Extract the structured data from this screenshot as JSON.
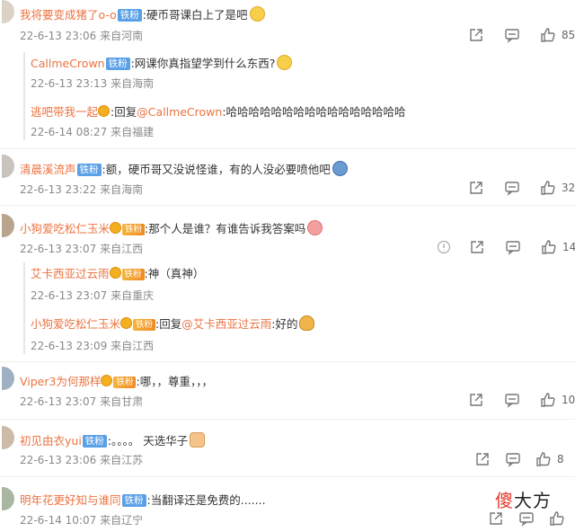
{
  "comments": [
    {
      "user": "我将要变成猪了o-o",
      "badge": "铁粉",
      "text": ":硬币哥课白上了是吧",
      "time": "22-6-13 23:06",
      "loc": "来自河南",
      "likes": "85",
      "replies": [
        {
          "user": "CallmeCrown",
          "badge": "铁粉",
          "text": ":网课你真指望学到什么东西?",
          "time": "22-6-13 23:13",
          "loc": "来自海南"
        },
        {
          "user": "逃吧带我一起",
          "prefix": ":回复",
          "mention": "@CallmeCrown",
          "text": ":哈哈哈哈哈哈哈哈哈哈哈哈哈哈哈哈",
          "time": "22-6-14 08:27",
          "loc": "来自福建"
        }
      ]
    },
    {
      "user": "清晨溪流声",
      "badge": "铁粉",
      "text": ":额，硬币哥又没说怪谁，有的人没必要喷他吧",
      "time": "22-6-13 23:22",
      "loc": "来自海南",
      "likes": "32"
    },
    {
      "user": "小狗爱吃松仁玉米",
      "badge": "铁粉",
      "text": ":那个人是谁？有谁告诉我答案吗",
      "time": "22-6-13 23:07",
      "loc": "来自江西",
      "likes": "14",
      "replies": [
        {
          "user": "艾卡西亚过云雨",
          "badge": "铁粉",
          "text": ":神（真神）",
          "time": "22-6-13 23:07",
          "loc": "来自重庆"
        },
        {
          "user": "小狗爱吃松仁玉米",
          "badge": "铁粉",
          "prefix": ":回复",
          "mention": "@艾卡西亚过云雨",
          "text": ":好的",
          "time": "22-6-13 23:09",
          "loc": "来自江西"
        }
      ]
    },
    {
      "user": "Viper3为何那样",
      "badge": "铁粉",
      "text": ":哪，，尊重，，，",
      "time": "22-6-13 23:07",
      "loc": "来自甘肃",
      "likes": "10"
    },
    {
      "user": "初见由衣yui",
      "badge": "铁粉",
      "text": ":。。。。  天选华子",
      "time": "22-6-13 23:06",
      "loc": "来自江苏",
      "likes": "8"
    },
    {
      "user": "明年花更好知与谁同",
      "badge": "铁粉",
      "text": ":当翻译还是免费的.......",
      "time": "22-6-14 10:07",
      "loc": "来自辽宁"
    }
  ],
  "watermark": {
    "first": "傻",
    "rest": "大方"
  },
  "icons": [
    "share-icon",
    "comment-icon",
    "like-icon",
    "report-icon"
  ],
  "colors": {
    "username": "#eb7340",
    "badge": "#5aa0e6",
    "meta": "#8a8a8a"
  }
}
